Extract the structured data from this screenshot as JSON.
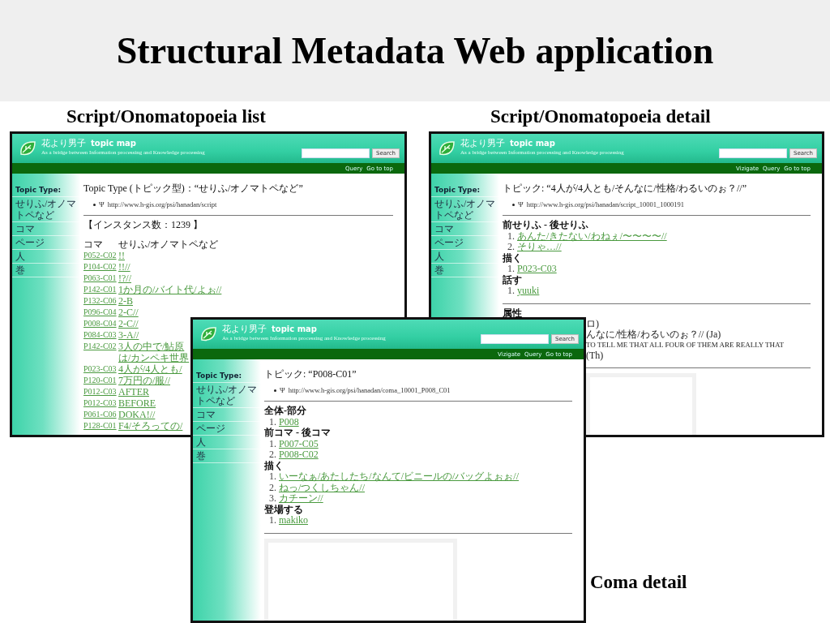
{
  "slide": {
    "title": "Structural Metadata Web application"
  },
  "windows": [
    {
      "kind": "list",
      "caption": "Script/Onomatopoeia list",
      "app_title": "花より男子",
      "app_name": "topic map",
      "tagline": "As a bridge between Information processing and Knowledge processing",
      "search_button": "Search",
      "nav_links": [
        "Query",
        "Go to top"
      ],
      "sidebar": {
        "heading": "Topic Type:",
        "items": [
          "せりふ/オノマトペなど",
          "コマ",
          "ページ",
          "人",
          "巻"
        ]
      },
      "title": "Topic Type (トピック型)：“せりふ/オノマトペなど”",
      "psi": "Ψ",
      "uri": "http://www.h-gis.org/psi/hanadan/script",
      "count": "【インスタンス数：1239 】",
      "table": {
        "columns": [
          "コマ",
          "せりふ/オノマトペなど"
        ],
        "rows": [
          {
            "code": "P052-C02",
            "value": "!!"
          },
          {
            "code": "P104-C02",
            "value": "!!//"
          },
          {
            "code": "P063-C01",
            "value": "!?//"
          },
          {
            "code": "P142-C01",
            "value": "1か月の/バイト代/よぉ//"
          },
          {
            "code": "P132-C06",
            "value": "2-B"
          },
          {
            "code": "P096-C04",
            "value": "2-C//"
          },
          {
            "code": "P008-C04",
            "value": "2-C//"
          },
          {
            "code": "P084-C03",
            "value": "3-A//"
          },
          {
            "code": "P142-C02",
            "value": "3人の中で/鮎原",
            "value_2": "は/カンペキ世界"
          },
          {
            "code": "P023-C03",
            "value": "4人が/4人とも/"
          },
          {
            "code": "P120-C01",
            "value": "7万円の/服//"
          },
          {
            "code": "P012-C03",
            "value": "AFTER"
          },
          {
            "code": "P012-C03",
            "value": "BEFORE"
          },
          {
            "code": "P061-C06",
            "value": "DOKA!//"
          },
          {
            "code": "P128-C01",
            "value": "F4/そろっての/"
          }
        ]
      }
    },
    {
      "kind": "detail",
      "caption": "Script/Onomatopoeia detail",
      "app_title": "花より男子",
      "app_name": "topic map",
      "tagline": "As a bridge between Information processing and Knowledge processing",
      "search_button": "Search",
      "nav_links": [
        "Vizigate",
        "Query",
        "Go to top"
      ],
      "sidebar": {
        "heading": "Topic Type:",
        "items": [
          "せりふ/オノマトペなど",
          "コマ",
          "ページ",
          "人",
          "巻"
        ]
      },
      "title": "トピック: “4人が/4人とも/そんなに/性格/わるいのぉ？//”",
      "psi": "Ψ",
      "uri": "http://www.h-gis.org/psi/hanadan/script_10001_1000191",
      "sections": [
        {
          "heading": "前せりふ - 後せりふ",
          "items": [
            {
              "num": "1.",
              "text": "あんた/きたない/わねぇ/〜〜〜〜//"
            },
            {
              "num": "2.",
              "text": "そりゃ…//"
            }
          ]
        },
        {
          "heading": "描く",
          "items": [
            {
              "num": "1.",
              "text": "P023-C03"
            }
          ]
        },
        {
          "heading": "話す",
          "items": [
            {
              "num": "1.",
              "text": "yuuki"
            }
          ]
        }
      ],
      "attributes": {
        "heading": "属性",
        "lines": [
          "ロ)",
          "んなに/性格/わるいのぉ？// (Ja)",
          "TO TELL ME THAT ALL FOUR OF THEM ARE REALLY THAT",
          "(Th)"
        ]
      }
    },
    {
      "kind": "detail",
      "caption": "Coma detail",
      "app_title": "花より男子",
      "app_name": "topic map",
      "tagline": "As a bridge between Information processing and Knowledge processing",
      "search_button": "Search",
      "nav_links": [
        "Vizigate",
        "Query",
        "Go to top"
      ],
      "sidebar": {
        "heading": "Topic Type:",
        "items": [
          "せりふ/オノマトペなど",
          "コマ",
          "ページ",
          "人",
          "巻"
        ]
      },
      "title": "トピック: “P008-C01”",
      "psi": "Ψ",
      "uri": "http://www.h-gis.org/psi/hanadan/coma_10001_P008_C01",
      "sections": [
        {
          "heading": "全体-部分",
          "items": [
            {
              "num": "1.",
              "text": "P008"
            }
          ]
        },
        {
          "heading": "前コマ - 後コマ",
          "items": [
            {
              "num": "1.",
              "text": "P007-C05"
            },
            {
              "num": "2.",
              "text": "P008-C02"
            }
          ]
        },
        {
          "heading": "描く",
          "items": [
            {
              "num": "1.",
              "text": "いーなぁ/あたしたち/なんて/ビニールの/バッグよぉぉ//"
            },
            {
              "num": "2.",
              "text": "ねっ/つくしちゃん//"
            },
            {
              "num": "3.",
              "text": "カチーン//"
            }
          ]
        },
        {
          "heading": "登場する",
          "items": [
            {
              "num": "1.",
              "text": "makiko"
            }
          ]
        }
      ],
      "image_frame": true
    }
  ]
}
